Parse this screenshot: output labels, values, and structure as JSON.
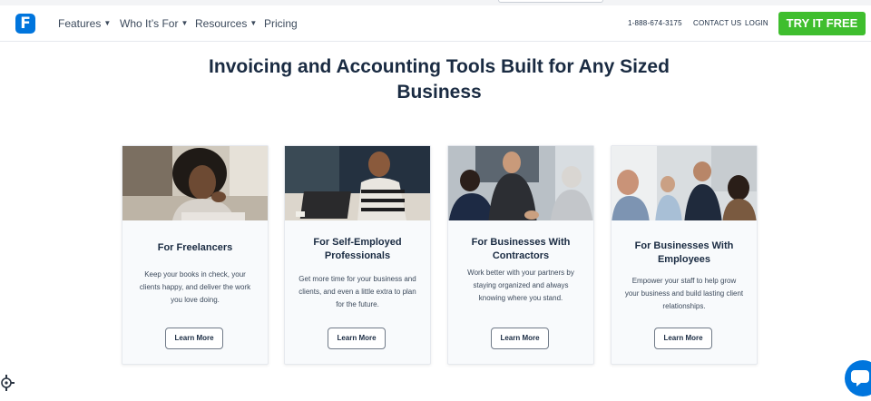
{
  "logo": {
    "letter": "F"
  },
  "nav": {
    "items": [
      {
        "label": "Features",
        "has_dropdown": true
      },
      {
        "label": "Who It’s For",
        "has_dropdown": true
      },
      {
        "label": "Resources",
        "has_dropdown": true
      },
      {
        "label": "Pricing",
        "has_dropdown": false
      }
    ],
    "chevron": "⌄"
  },
  "header_right": {
    "phone": "1-888-674-3175",
    "contact": "CONTACT US",
    "login": "LOGIN",
    "cta": "TRY IT FREE"
  },
  "main": {
    "heading": "Invoicing and Accounting Tools Built for Any Sized Business"
  },
  "cards": [
    {
      "title": "For Freelancers",
      "description": "Keep your books in check, your clients happy, and deliver the work you love doing.",
      "button": "Learn More"
    },
    {
      "title": "For Self-Employed Professionals",
      "description": "Get more time for your business and clients, and even a little extra to plan for the future.",
      "button": "Learn More"
    },
    {
      "title": "For Businesses With Contractors",
      "description": "Work better with your partners by staying organized and always knowing where you stand.",
      "button": "Learn More"
    },
    {
      "title": "For Businesses With Employees",
      "description": "Empower your staff to help grow your business and build lasting client relationships.",
      "button": "Learn More"
    }
  ],
  "colors": {
    "brand_blue": "#0075dd",
    "cta_green": "#3fbe2e",
    "heading": "#1a2b42"
  },
  "icons": [
    "chevron-down-icon",
    "chat-icon",
    "gear-icon"
  ]
}
